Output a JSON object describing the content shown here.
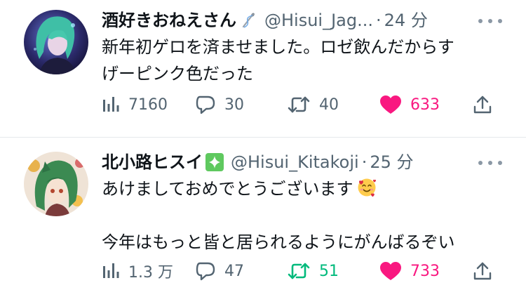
{
  "tweets": [
    {
      "name": "酒好きおねえさん",
      "badge": "needle-thread-icon",
      "handle": "@Hisui_Jag...",
      "separator": "·",
      "time": "24 分",
      "text_lines": [
        "新年初ゲロを済ませました。ロゼ飲んだからす",
        "げーピンク色だった"
      ],
      "views": "7160",
      "replies": "30",
      "retweets": "40",
      "likes": "633",
      "retweeted": false,
      "liked": true
    },
    {
      "name": "北小路ヒスイ",
      "badge": "sparkles-icon",
      "handle": "@Hisui_Kitakoji",
      "separator": "·",
      "time": "25 分",
      "text_lines": [
        "あけましておめでとうございます",
        "",
        "今年はもっと皆と居られるようにがんばるぞい"
      ],
      "emoji": "smiling-face-with-hearts",
      "views": "1.3 万",
      "replies": "47",
      "retweets": "51",
      "likes": "733",
      "retweeted": true,
      "liked": true
    }
  ],
  "colors": {
    "text": "#0f1419",
    "muted": "#536471",
    "like": "#f91880",
    "retweet": "#00ba7c",
    "divider": "#e6e9ec"
  }
}
